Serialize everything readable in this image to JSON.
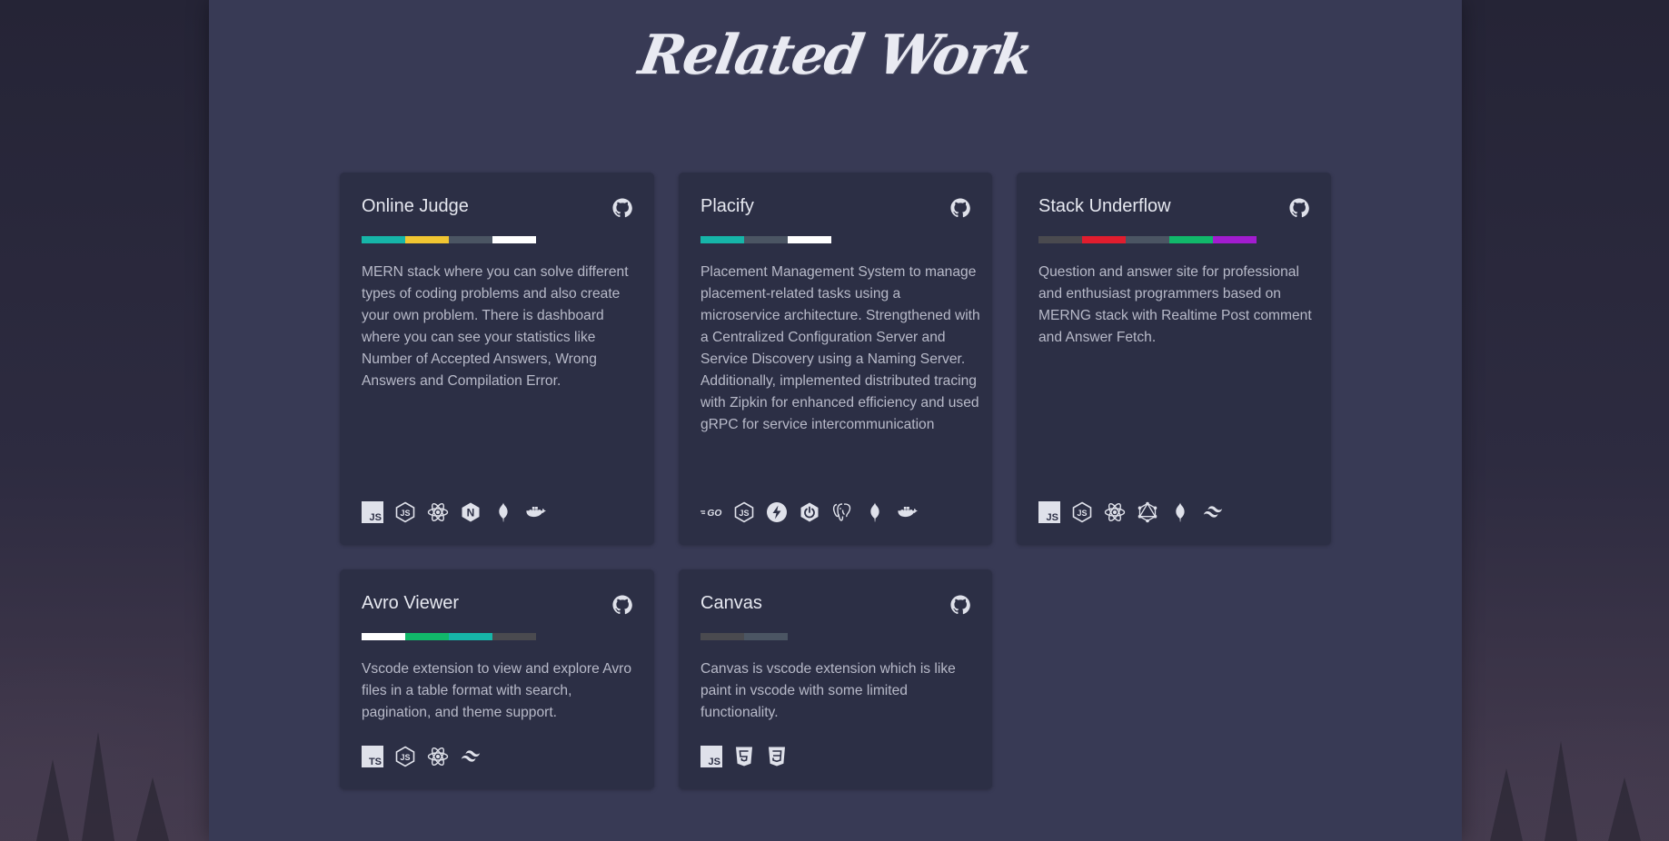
{
  "page": {
    "title": "Related Work"
  },
  "projects": [
    {
      "title": "Online Judge",
      "description": "MERN stack where you can solve different types of coding problems and also create your own problem. There is dashboard where you can see your statistics like Number of Accepted Answers, Wrong Answers and Compilation Error.",
      "bar_colors": [
        "#16b5a8",
        "#f1c632",
        "#4b5563",
        "#ffffff"
      ],
      "tech_icons": [
        "javascript-icon",
        "nodejs-icon",
        "react-icon",
        "nextjs-icon",
        "mongodb-icon",
        "docker-icon"
      ]
    },
    {
      "title": "Placify",
      "description": "Placement Management System to manage placement-related tasks using a microservice architecture. Strengthened with a Centralized Configuration Server and Service Discovery using a Naming Server. Additionally, implemented distributed tracing with Zipkin for enhanced efficiency and used gRPC for service intercommunication",
      "bar_colors": [
        "#16b5a8",
        "#4b5563",
        "#ffffff"
      ],
      "tech_icons": [
        "go-icon",
        "nodejs-icon",
        "spring-icon",
        "spring-boot-icon",
        "postgresql-icon",
        "mongodb-icon",
        "docker-icon"
      ]
    },
    {
      "title": "Stack Underflow",
      "description": "Question and answer site for professional and enthusiast programmers based on MERNG stack with Realtime Post comment and Answer Fetch.",
      "bar_colors": [
        "#4a4a4f",
        "#e11d2e",
        "#4b5563",
        "#11b86a",
        "#a21ccf"
      ],
      "tech_icons": [
        "javascript-icon",
        "nodejs-icon",
        "react-icon",
        "graphql-icon",
        "mongodb-icon",
        "tailwind-icon"
      ]
    },
    {
      "title": "Avro Viewer",
      "description": "Vscode extension to view and explore Avro files in a table format with search, pagination, and theme support.",
      "bar_colors": [
        "#ffffff",
        "#11b86a",
        "#16b5a8",
        "#4a4a4f"
      ],
      "tech_icons": [
        "typescript-icon",
        "nodejs-icon",
        "react-icon",
        "tailwind-icon"
      ]
    },
    {
      "title": "Canvas",
      "description": "Canvas is vscode extension which is like paint in vscode with some limited functionality.",
      "bar_colors": [
        "#4a4a4f",
        "#4b5563"
      ],
      "tech_icons": [
        "javascript-icon",
        "html5-icon",
        "css3-icon"
      ]
    }
  ]
}
